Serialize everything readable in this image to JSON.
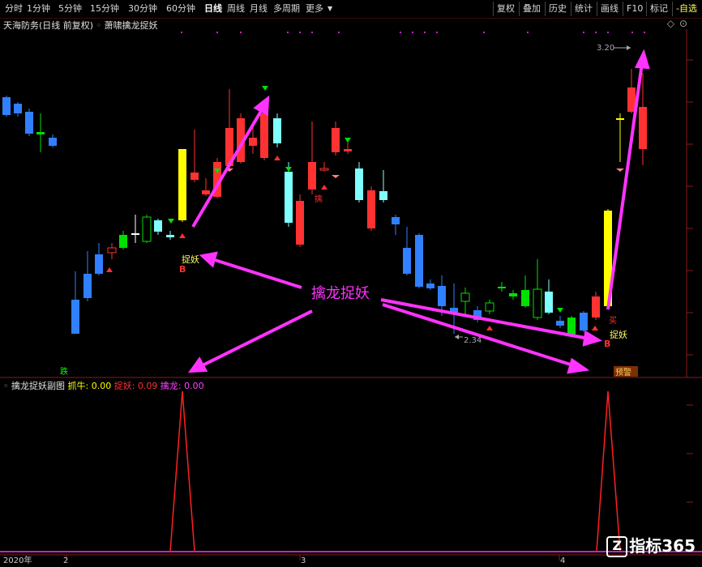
{
  "toolbar": {
    "periods": [
      "分时",
      "1分钟",
      "5分钟",
      "15分钟",
      "30分钟",
      "60分钟",
      "日线",
      "周线",
      "月线",
      "多周期",
      "更多"
    ],
    "active": "日线",
    "right_buttons": [
      "复权",
      "叠加",
      "历史",
      "统计",
      "画线",
      "F10",
      "标记",
      "-自选"
    ]
  },
  "title": {
    "stock": "天海防务",
    "mode": "(日线 前复权)",
    "indicator": "萧啸擒龙捉妖",
    "settings_icon": "diamond-icon"
  },
  "main_chart": {
    "annotation_main": "擒龙捉妖",
    "label_zhuoyao_1": "捉妖",
    "label_zhuoyao_2": "捉妖",
    "label_b1": "B",
    "label_b2": "B",
    "label_mai": "买",
    "label_die": "跌",
    "label_qin": "擒",
    "label_yujing": "预警",
    "price_high": "3.20",
    "price_low": "2.34"
  },
  "sub_chart": {
    "name": "擒龙捉妖副图",
    "items": [
      {
        "label": "抓牛: 0.00",
        "color": "#ffff00"
      },
      {
        "label": "捉妖: 0.09",
        "color": "#ff3030"
      },
      {
        "label": "擒龙: 0.00",
        "color": "#ff40ff"
      }
    ]
  },
  "x_axis": {
    "labels": [
      "2020年",
      "2",
      "3",
      "4"
    ]
  },
  "watermark": {
    "icon": "Z",
    "text": "指标365"
  },
  "colors": {
    "up": "#ff3232",
    "down_blue": "#3080ff",
    "cyan": "#80ffff",
    "green": "#00e000",
    "yellow": "#ffff00",
    "magenta": "#ff33ff"
  }
}
